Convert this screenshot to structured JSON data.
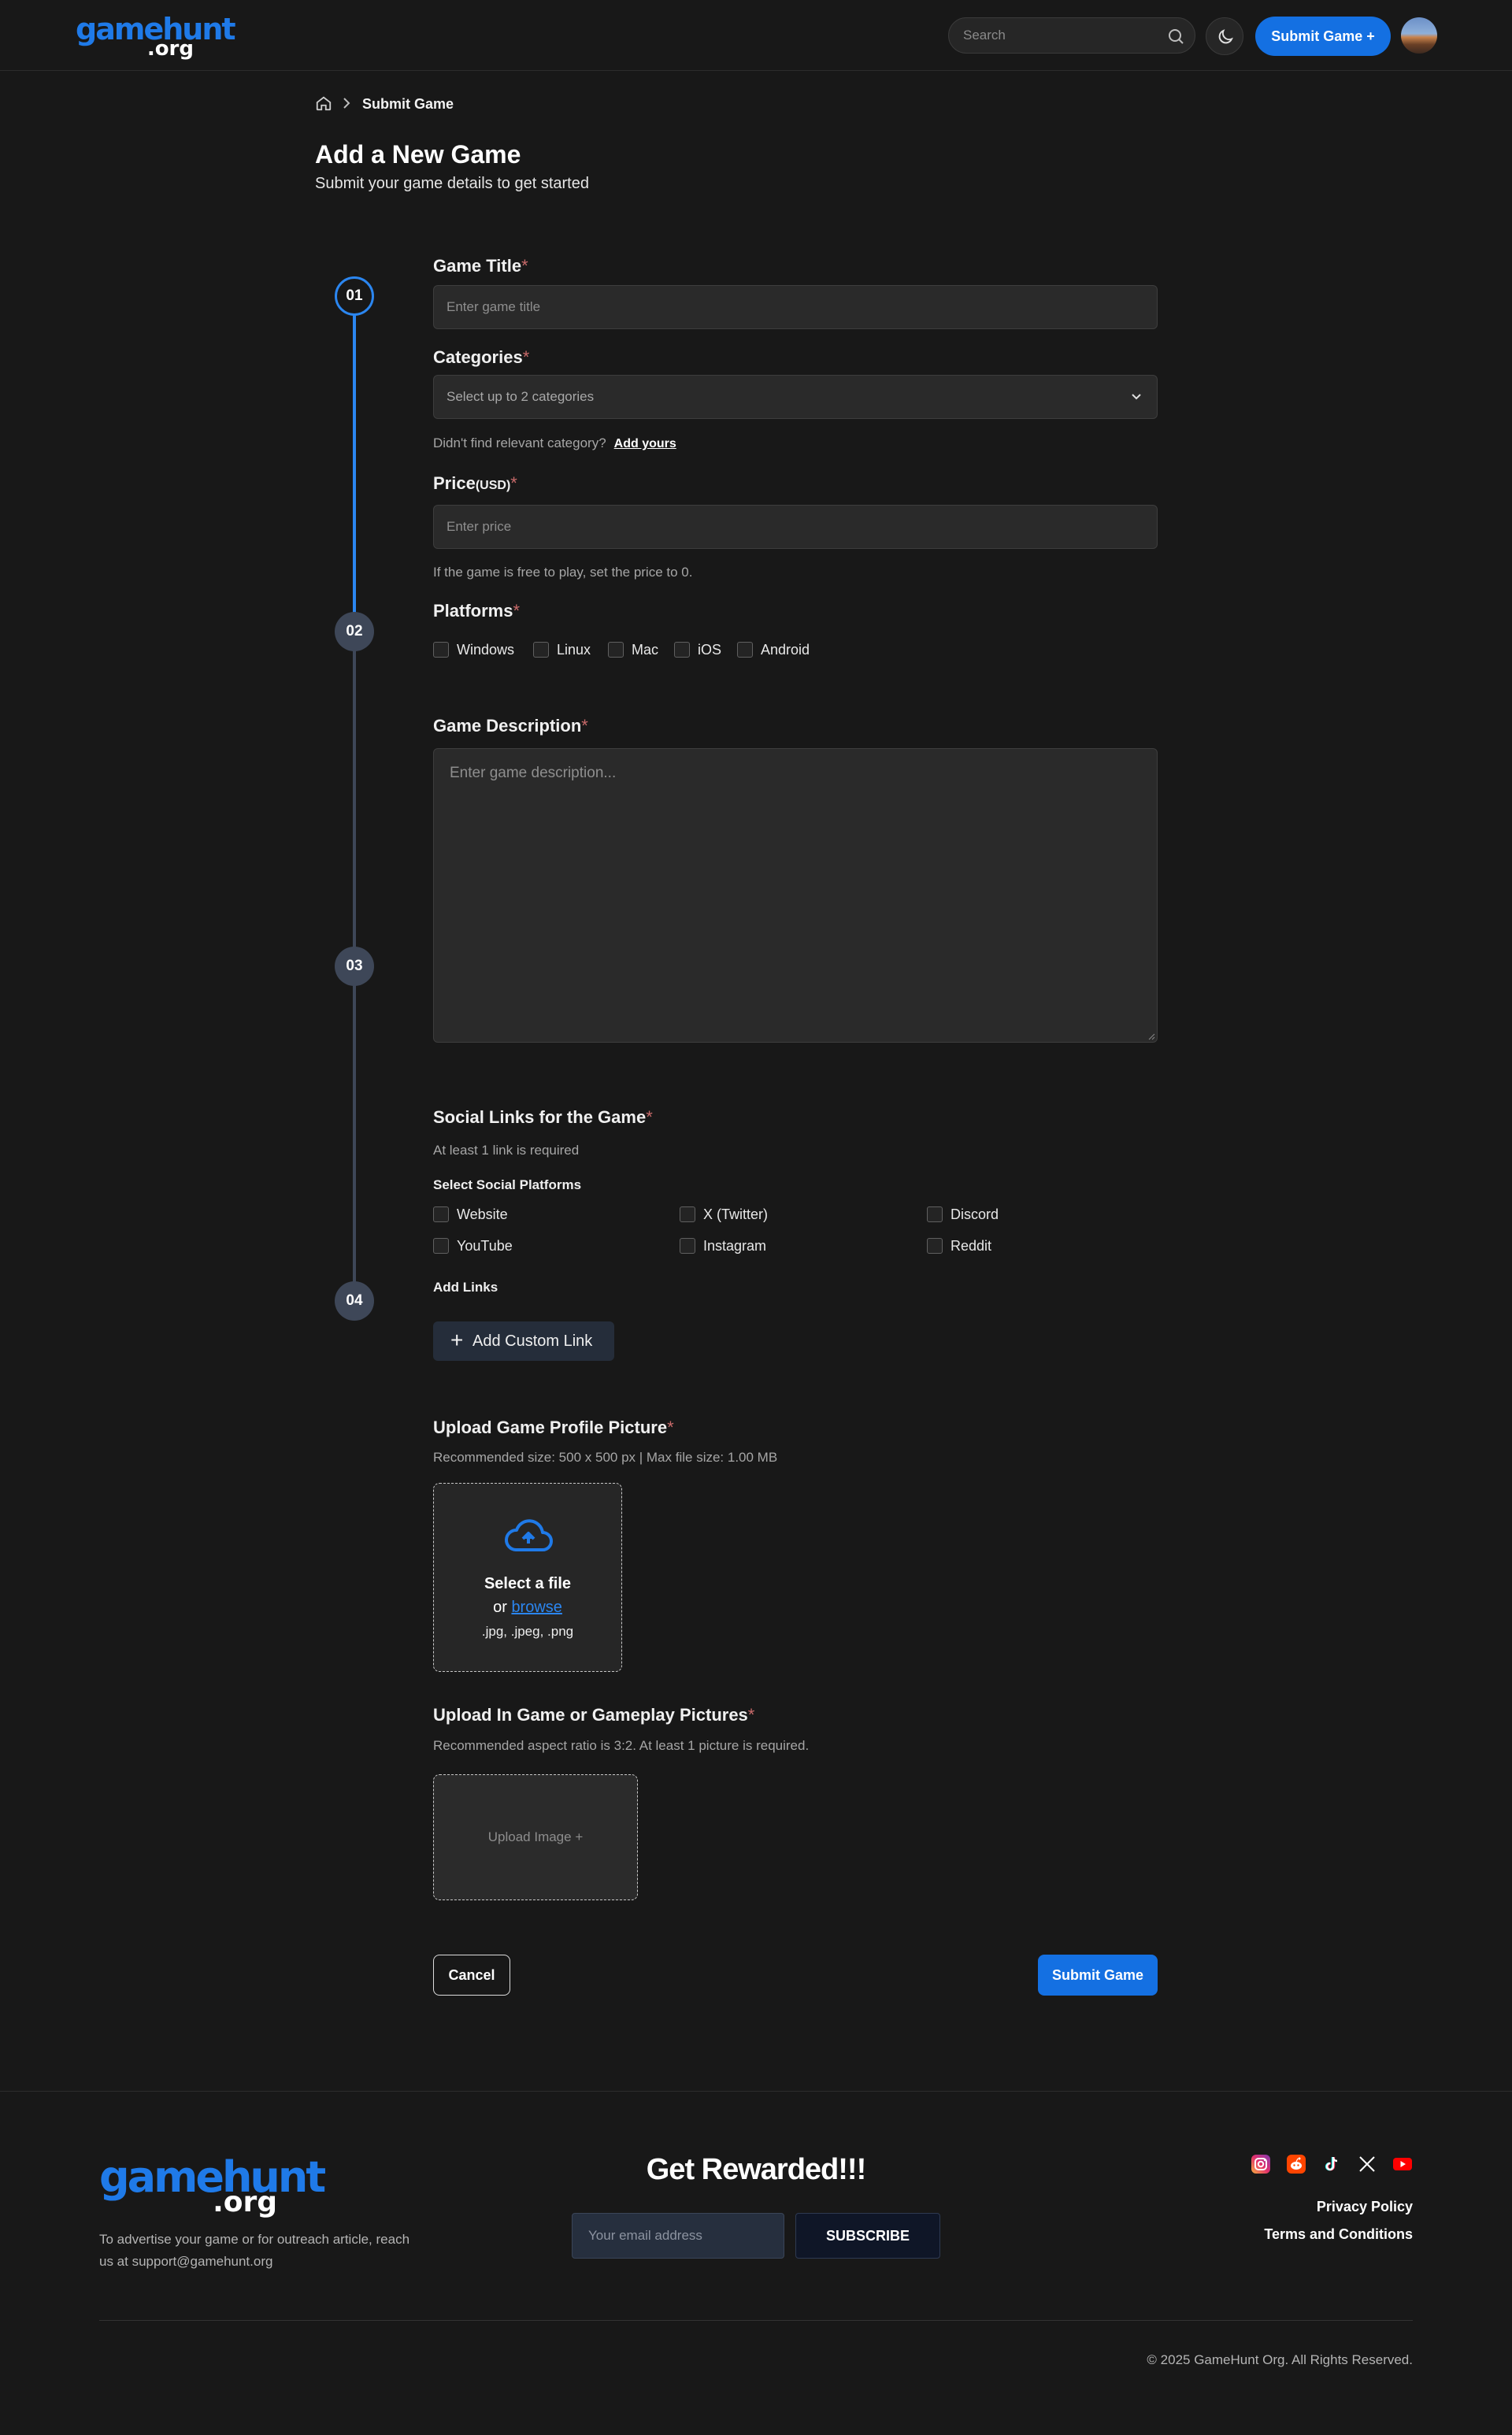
{
  "header": {
    "logo_main": "gamehunt",
    "logo_tld": ".org",
    "search_placeholder": "Search",
    "submit_label": "Submit Game +"
  },
  "breadcrumb": {
    "current": "Submit Game"
  },
  "page": {
    "title": "Add a New Game",
    "subtitle": "Submit your game details to get started"
  },
  "stepper": {
    "steps": [
      "01",
      "02",
      "03",
      "04"
    ],
    "active_step": 1,
    "progress_step_fraction": 0.25,
    "active_color": "#2b86f0",
    "idle_color": "#3e4758"
  },
  "form": {
    "required_mark": "*",
    "title": {
      "label": "Game Title",
      "placeholder": "Enter game title"
    },
    "categories": {
      "label": "Categories",
      "placeholder": "Select up to 2 categories",
      "hint": "Didn't find relevant category?",
      "add_link": "Add yours"
    },
    "price": {
      "label": "Price",
      "unit": "(USD)",
      "placeholder": "Enter price",
      "hint": "If the game is free to play, set the price to 0."
    },
    "platforms": {
      "label": "Platforms",
      "options": [
        "Windows",
        "Linux",
        "Mac",
        "iOS",
        "Android"
      ]
    },
    "description": {
      "label": "Game Description",
      "placeholder": "Enter game description..."
    },
    "social": {
      "label": "Social Links for the Game",
      "hint": "At least 1 link is required",
      "select_label": "Select Social Platforms",
      "options": [
        "Website",
        "X (Twitter)",
        "Discord",
        "YouTube",
        "Instagram",
        "Reddit"
      ],
      "add_links_label": "Add Links",
      "add_custom_label": "Add Custom Link"
    },
    "profile_picture": {
      "label": "Upload Game Profile Picture",
      "hint": "Recommended size: 500 x 500 px | Max file size: 1.00 MB",
      "select_text": "Select a file",
      "or_text": "or",
      "browse_text": "browse",
      "formats": ".jpg, .jpeg, .png"
    },
    "gameplay_pictures": {
      "label": "Upload In Game or Gameplay Pictures",
      "hint": "Recommended aspect ratio is 3:2. At least 1 picture is required.",
      "upload_label": "Upload Image +"
    },
    "cancel_label": "Cancel",
    "submit_label": "Submit Game"
  },
  "footer": {
    "logo_main": "gamehunt",
    "logo_tld": ".org",
    "advertise_text": "To advertise your game or for outreach article, reach us at support@gamehunt.org",
    "rewarded_title": "Get Rewarded!!!",
    "email_placeholder": "Your email address",
    "subscribe_label": "SUBSCRIBE",
    "social_icons": [
      "instagram-icon",
      "reddit-icon",
      "tiktok-icon",
      "x-icon",
      "youtube-icon"
    ],
    "privacy_label": "Privacy Policy",
    "terms_label": "Terms and Conditions",
    "copyright": "© 2025 GameHunt Org. All Rights Reserved."
  },
  "colors": {
    "accent": "#1470e2",
    "background": "#181818",
    "brand_blue": "#1f7ae8"
  }
}
